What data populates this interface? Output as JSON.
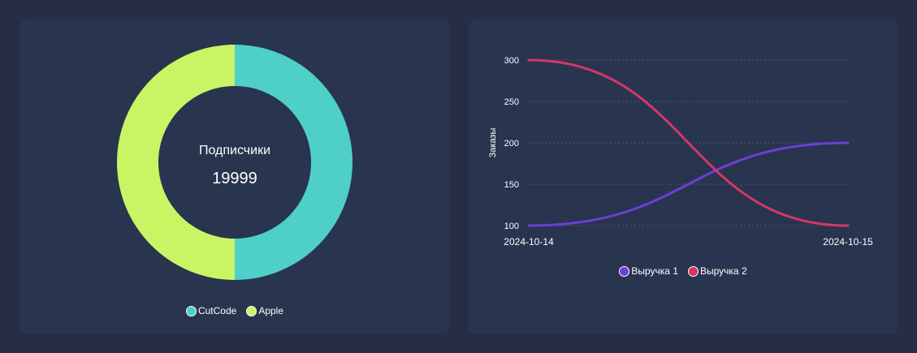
{
  "colors": {
    "page_bg": "#272d45",
    "card_bg": "#29344f",
    "grid": "#4d5872"
  },
  "donut": {
    "center_title": "Подписчики",
    "center_value": "19999"
  },
  "line": {},
  "chart_data": [
    {
      "type": "pie",
      "variant": "doughnut",
      "title": "",
      "series": [
        {
          "name": "CutCode",
          "value": 50,
          "color": "#4ecfc7"
        },
        {
          "name": "Apple",
          "value": 50,
          "color": "#c8f564"
        }
      ],
      "legend": "bottom"
    },
    {
      "type": "line",
      "x": [
        "2024-10-14",
        "2024-10-15"
      ],
      "ylabel": "Заказы",
      "ylim": [
        100,
        300
      ],
      "yticks": [
        100,
        150,
        200,
        250,
        300
      ],
      "grid": true,
      "smooth": true,
      "series": [
        {
          "name": "Выручка 1",
          "values": [
            100,
            200
          ],
          "color": "#6c3fd6"
        },
        {
          "name": "Выручка 2",
          "values": [
            300,
            100
          ],
          "color": "#d63767"
        }
      ],
      "legend": "bottom"
    }
  ]
}
